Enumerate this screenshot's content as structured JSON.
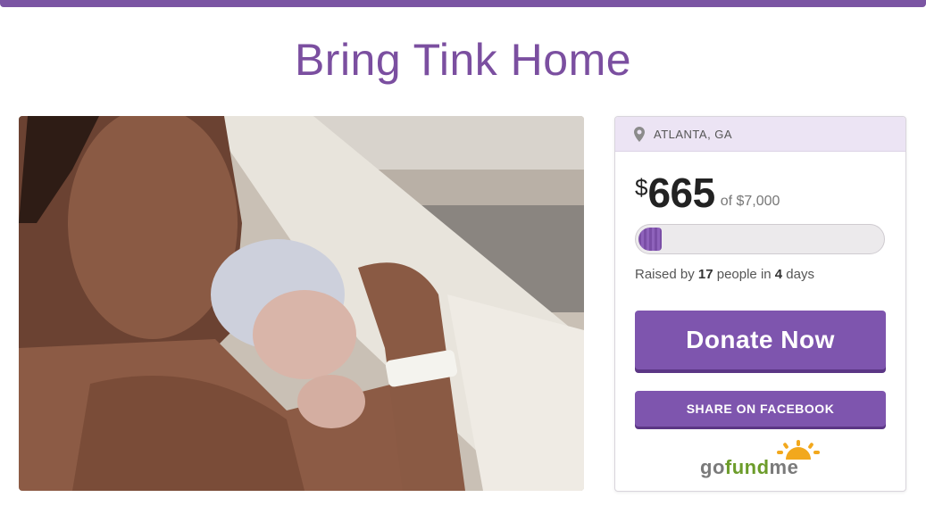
{
  "page": {
    "title": "Bring Tink Home"
  },
  "photo": {
    "description_icon": "photo-image"
  },
  "campaign": {
    "location": "ATLANTA, GA",
    "currency_symbol": "$",
    "amount_raised": "665",
    "goal_text": "of $7,000",
    "progress_fraction": 0.095,
    "raised_prefix": "Raised by ",
    "people_count": "17",
    "people_mid": " people in ",
    "days_count": "4",
    "days_suffix": " days",
    "donate_label": "Donate Now",
    "share_label": "SHARE ON FACEBOOK"
  },
  "logo": {
    "go": "go",
    "fund": "fund",
    "me": "me"
  },
  "colors": {
    "brand_purple": "#7b4fa0",
    "button_purple": "#7e55ae",
    "location_bg": "#ece4f4",
    "logo_green": "#6c9c2a",
    "logo_orange": "#f2a81d"
  }
}
